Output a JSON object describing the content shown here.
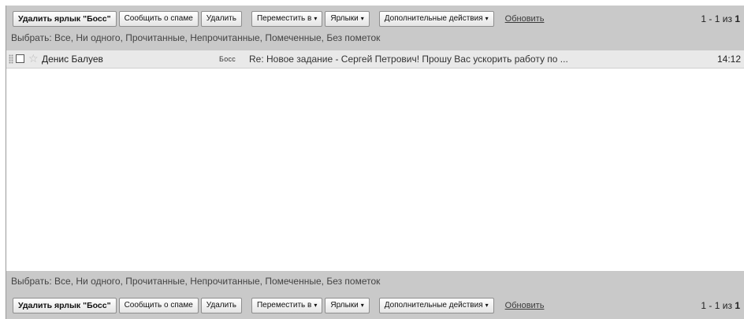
{
  "toolbar": {
    "remove_label": "Удалить ярлык \"Босс\"",
    "report_spam": "Сообщить о спаме",
    "delete": "Удалить",
    "move_to": "Переместить в",
    "labels": "Ярлыки",
    "more_actions": "Дополнительные действия",
    "refresh": "Обновить",
    "caret": "▾"
  },
  "paging": {
    "range": "1 - 1",
    "of": "из",
    "total": "1"
  },
  "select": {
    "prefix": "Выбрать:",
    "options": [
      "Все",
      "Ни одного",
      "Прочитанные",
      "Непрочитанные",
      "Помеченные",
      "Без пометок"
    ]
  },
  "message": {
    "sender": "Денис Балуев",
    "label": "Босс",
    "subject": "Re: Новое задание - Сергей Петрович! Прошу Вас ускорить работу по ...",
    "time": "14:12",
    "star_icon": "star-outline-icon",
    "checked": false
  },
  "colors": {
    "bar": "#c9c9c9",
    "row": "#e9e9e9",
    "background": "#ffffff"
  }
}
